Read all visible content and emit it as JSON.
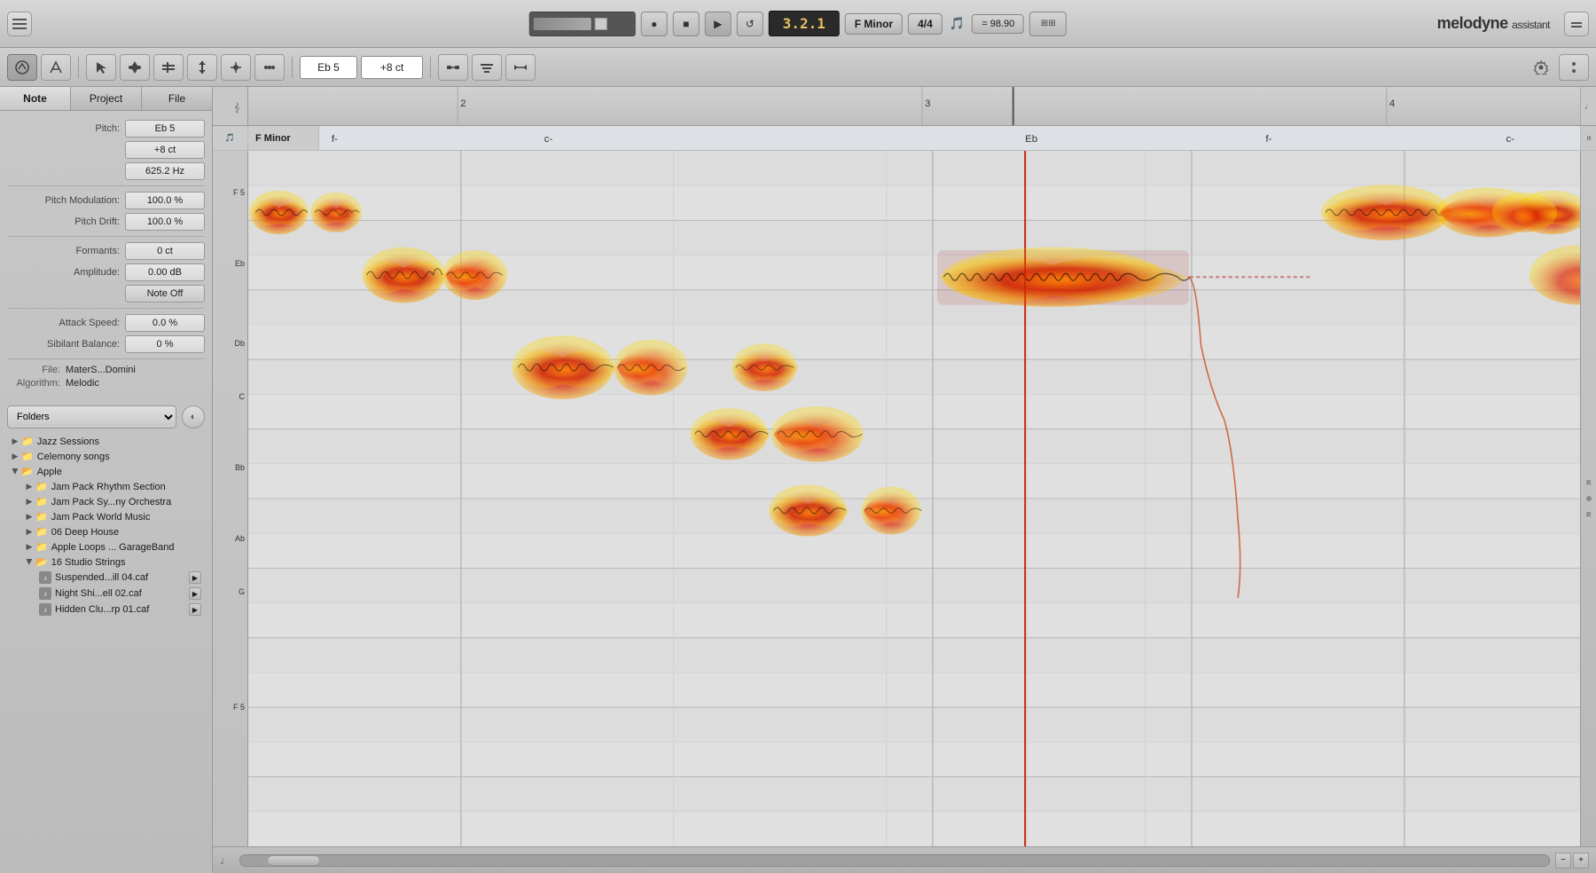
{
  "app": {
    "title": "Melodyne assistant",
    "logo_text": "melodyne",
    "logo_sub": "assistant"
  },
  "transport": {
    "position": "3.2.1",
    "key": "F Minor",
    "key_short": "Minor",
    "time_sig": "4/4",
    "tempo": "= 98.90",
    "record_label": "●",
    "stop_label": "■",
    "play_label": "▶",
    "loop_label": "↺"
  },
  "toolbar": {
    "pitch_value": "Eb 5",
    "cents_value": "+8 ct",
    "tools": [
      "pitch-tool",
      "select-tool",
      "pitch-drag-tool",
      "pitch-scale-tool",
      "pitch-time-tool",
      "pitch-snap-tool",
      "pitch-extra-tool"
    ]
  },
  "left_tabs": [
    {
      "label": "Note",
      "active": true
    },
    {
      "label": "Project",
      "active": false
    },
    {
      "label": "File",
      "active": false
    }
  ],
  "note_props": {
    "pitch_label": "Pitch:",
    "pitch_value": "Eb 5",
    "pitch_cents": "+8 ct",
    "pitch_hz": "625.2 Hz",
    "pitch_mod_label": "Pitch Modulation:",
    "pitch_mod_value": "100.0 %",
    "pitch_drift_label": "Pitch Drift:",
    "pitch_drift_value": "100.0 %",
    "formants_label": "Formants:",
    "formants_value": "0 ct",
    "amplitude_label": "Amplitude:",
    "amplitude_value": "0.00 dB",
    "note_off_label": "Note Off",
    "attack_label": "Attack Speed:",
    "attack_value": "0.0 %",
    "sibilant_label": "Sibilant Balance:",
    "sibilant_value": "0 %",
    "file_label": "File:",
    "file_value": "MaterS...Domini",
    "algorithm_label": "Algorithm:",
    "algorithm_value": "Melodic"
  },
  "browser": {
    "selector_label": "Folders",
    "items": [
      {
        "label": "Jazz Sessions",
        "type": "folder",
        "depth": 0,
        "expanded": false
      },
      {
        "label": "Celemony songs",
        "type": "folder",
        "depth": 0,
        "expanded": false
      },
      {
        "label": "Apple",
        "type": "folder",
        "depth": 0,
        "expanded": true,
        "children": [
          {
            "label": "Jam Pack Rhythm Section",
            "type": "folder",
            "depth": 1,
            "expanded": false
          },
          {
            "label": "Jam Pack Sy...ny Orchestra",
            "type": "folder",
            "depth": 1,
            "expanded": false
          },
          {
            "label": "Jam Pack World Music",
            "type": "folder",
            "depth": 1,
            "expanded": false
          },
          {
            "label": "06 Deep House",
            "type": "folder",
            "depth": 1,
            "expanded": false
          },
          {
            "label": "Apple Loops ... GarageBand",
            "type": "folder",
            "depth": 1,
            "expanded": false
          },
          {
            "label": "16 Studio Strings",
            "type": "folder",
            "depth": 1,
            "expanded": true,
            "children": [
              {
                "label": "Suspended...ill 04.caf",
                "type": "file"
              },
              {
                "label": "Night Shi...ell 02.caf",
                "type": "file"
              },
              {
                "label": "Hidden Clu...rp 01.caf",
                "type": "file"
              }
            ]
          }
        ]
      }
    ]
  },
  "piano_roll": {
    "key_sig": "F Minor",
    "chords": [
      "f-",
      "c-",
      "Eb",
      "f-",
      "c-"
    ],
    "timeline_marks": [
      "2",
      "3",
      "4"
    ],
    "pitch_labels": [
      "F 5",
      "Eb",
      "Db",
      "C",
      "Bb",
      "Ab",
      "G",
      "F 5"
    ],
    "position": "3.2.1"
  },
  "status_bar": {
    "minor_label": "Minor"
  }
}
